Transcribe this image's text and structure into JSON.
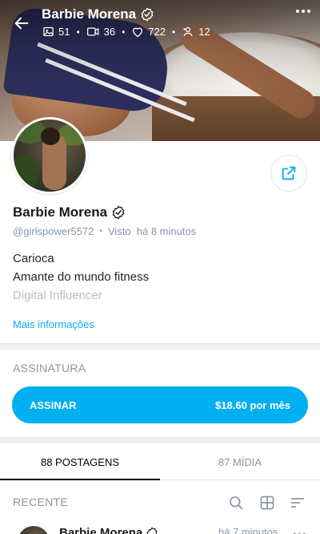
{
  "header": {
    "title": "Barbie Morena",
    "stats": [
      {
        "icon": "image-icon",
        "value": "51"
      },
      {
        "icon": "video-icon",
        "value": "36"
      },
      {
        "icon": "heart-icon",
        "value": "722"
      },
      {
        "icon": "fans-icon",
        "value": "12"
      }
    ]
  },
  "profile": {
    "name": "Barbie Morena",
    "handle": "@girlspower5572",
    "seen": "Visto  há 8 minutos",
    "bio": [
      "Carioca",
      "Amante do mundo fitness",
      "Digital Influencer"
    ],
    "more_info": "Mais informações"
  },
  "subscription": {
    "title": "ASSINATURA",
    "button_label": "ASSINAR",
    "price": "$18.60 por mês"
  },
  "tabs": [
    {
      "label": "88 POSTAGENS",
      "active": true
    },
    {
      "label": "87 MÍDIA",
      "active": false
    }
  ],
  "recent": {
    "label": "RECENTE"
  },
  "post": {
    "author": "Barbie Morena",
    "time": "há 7 minutos"
  },
  "colors": {
    "accent": "#00aff0",
    "muted": "#8a96a3"
  }
}
